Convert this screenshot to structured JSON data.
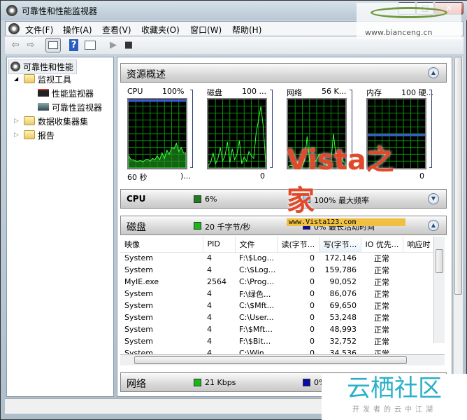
{
  "window": {
    "title": "可靠性和性能监视器",
    "min": "–",
    "max": "□",
    "close": "✕"
  },
  "menu": [
    "文件(F)",
    "操作(A)",
    "查看(V)",
    "收藏夹(O)",
    "窗口(W)",
    "帮助(H)"
  ],
  "toolbar": {
    "back": "⇦",
    "forward": "⇨",
    "help": "?",
    "play": "▶",
    "stop": "■"
  },
  "tree": {
    "root": "可靠性和性能",
    "monitor_tools": "监视工具",
    "perf_monitor": "性能监视器",
    "rel_monitor": "可靠性监视器",
    "collector_sets": "数据收集器集",
    "reports": "报告",
    "expanded": "◢",
    "collapsed": "▷"
  },
  "overview": {
    "title": "资源概述",
    "graphs": [
      {
        "name": "CPU",
        "max": "100%",
        "min": "60 秒",
        "min2": ")...",
        "line": "#3a5bd9",
        "values": [
          18,
          12,
          12,
          10,
          10,
          11,
          9,
          12,
          13,
          10,
          14,
          12,
          18,
          12,
          22,
          14,
          26,
          20,
          30,
          28,
          36,
          24,
          30,
          22,
          22
        ],
        "flat": 98
      },
      {
        "name": "磁盘",
        "max": "100 ...",
        "min2": "0",
        "values": [
          4,
          8,
          22,
          6,
          14,
          30,
          10,
          18,
          38,
          8,
          28,
          12,
          20,
          40,
          6,
          16,
          10,
          24,
          18,
          14,
          50,
          70,
          90,
          60,
          8
        ],
        "flat": null
      },
      {
        "name": "网络",
        "max": "56 K...",
        "min2": "",
        "values": [
          2,
          4,
          3,
          5,
          8,
          6,
          4,
          12,
          46,
          10,
          6,
          8,
          12,
          20,
          14,
          6,
          4,
          10,
          8,
          50,
          20,
          22,
          18,
          10,
          6
        ],
        "flat": null
      },
      {
        "name": "内存",
        "max": "100 硬...",
        "min2": "0",
        "values": [],
        "flat": 48
      }
    ]
  },
  "cpu": {
    "title": "CPU",
    "usage": "6%",
    "freq": "100% 最大频率",
    "sw1": "#1e7d1e",
    "sw2": "#6cb4f0"
  },
  "disk": {
    "title": "磁盘",
    "rate": "20 千字节/秒",
    "active": "0% 最长活动时间",
    "sw1": "#17b817",
    "sw2": "#0a0aa8",
    "columns": [
      "映像",
      "PID",
      "文件",
      "读(字节...",
      "写(字节...",
      "IO 优先...",
      "响应时"
    ],
    "rows": [
      [
        "System",
        "4",
        "F:\\$Log...",
        "0",
        "172,146",
        "正常"
      ],
      [
        "System",
        "4",
        "C:\\$Log...",
        "0",
        "159,786",
        "正常"
      ],
      [
        "MyIE.exe",
        "2564",
        "C:\\Prog...",
        "0",
        "90,052",
        "正常"
      ],
      [
        "System",
        "4",
        "F:\\绿色...",
        "0",
        "86,076",
        "正常"
      ],
      [
        "System",
        "4",
        "C:\\$Mft...",
        "0",
        "69,650",
        "正常"
      ],
      [
        "System",
        "4",
        "C:\\User...",
        "0",
        "53,248",
        "正常"
      ],
      [
        "System",
        "4",
        "F:\\$Mft...",
        "0",
        "48,993",
        "正常"
      ],
      [
        "System",
        "4",
        "F:\\$Bit...",
        "0",
        "32,752",
        "正常"
      ],
      [
        "System",
        "4",
        "C:\\Win...",
        "0",
        "34,536",
        "正常"
      ]
    ]
  },
  "network": {
    "title": "网络",
    "rate": "21 Kbps",
    "util": "0%"
  },
  "watermarks": {
    "top": "www.bianceng.cn",
    "vista": "Vista之家",
    "vista_url": "www.Vista123.com",
    "yunqi": "云栖社区",
    "yunqi_sub": "开发者的云中江湖"
  }
}
